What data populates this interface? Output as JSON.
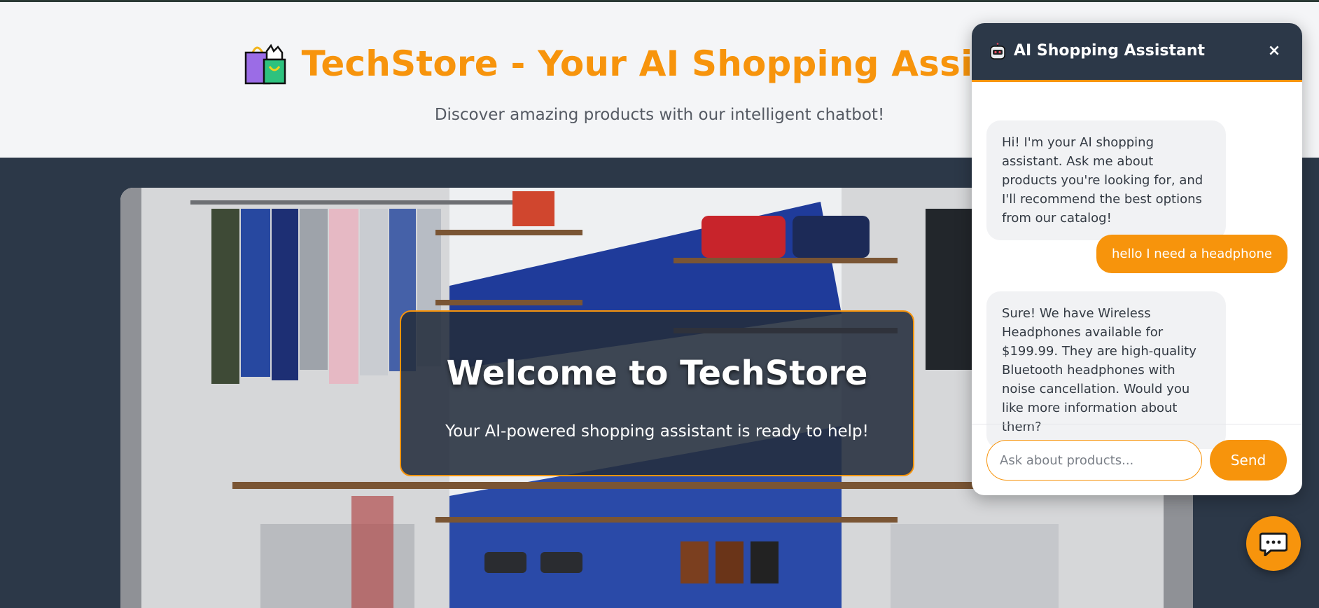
{
  "header": {
    "title": "TechStore - Your AI Shopping Assistant",
    "subtitle": "Discover amazing products with our intelligent chatbot!"
  },
  "hero": {
    "title": "Welcome to TechStore",
    "subtitle": "Your AI-powered shopping assistant is ready to help!"
  },
  "chat": {
    "title": "AI Shopping Assistant",
    "close_label": "×",
    "messages": [
      {
        "role": "bot",
        "text": "Hi! I'm your AI shopping assistant. Ask me about products you're looking for, and I'll recommend the best options from our catalog!"
      },
      {
        "role": "user",
        "text": "hello I need a headphone"
      },
      {
        "role": "bot",
        "text": "Sure! We have Wireless Headphones available for $199.99. They are high-quality Bluetooth headphones with noise cancellation. Would you like more information about them?"
      }
    ],
    "input_placeholder": "Ask about products...",
    "input_value": "",
    "send_label": "Send"
  },
  "colors": {
    "accent": "#f7940c",
    "dark": "#2c3848",
    "header_bg": "#f4f5f7"
  },
  "icons": {
    "title_icon": "shopping-bags-icon",
    "chat_icon": "robot-icon",
    "fab_icon": "chat-bubble-icon"
  }
}
